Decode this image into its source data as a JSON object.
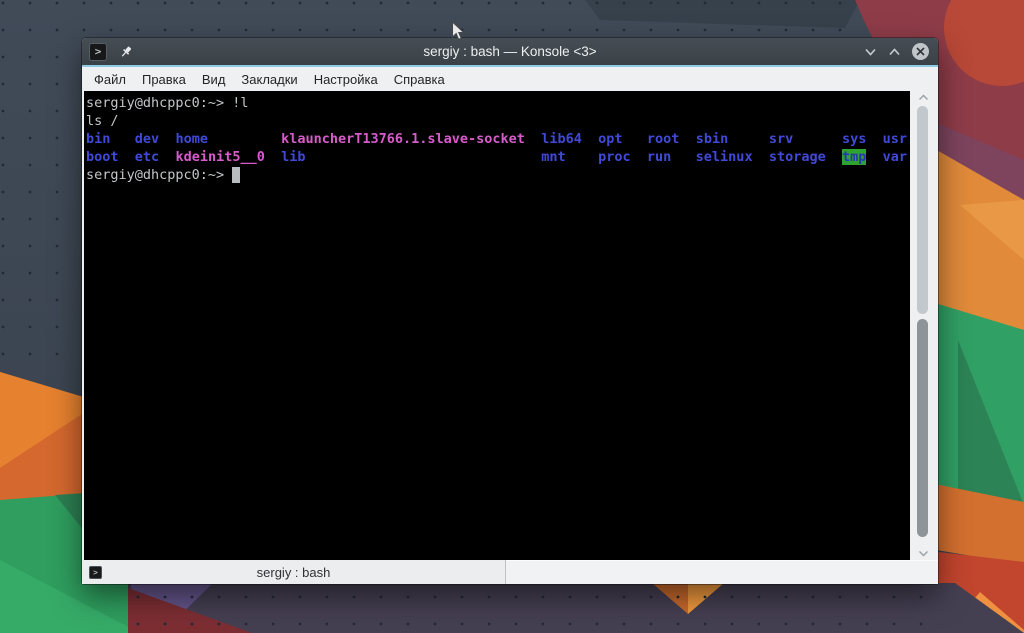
{
  "window": {
    "title": "sergiy : bash — Konsole <3>",
    "app_icon_glyph": ">",
    "titlebar_buttons": {
      "minimize": "chevron-down",
      "maximize": "chevron-up",
      "close": "circle-x",
      "pin": "keep-above-pin"
    },
    "menu": {
      "items": [
        "Файл",
        "Правка",
        "Вид",
        "Закладки",
        "Настройка",
        "Справка"
      ]
    },
    "terminal": {
      "colors": {
        "background": "#000000",
        "foreground": "#c3c7c9",
        "directory_blue": "#4149d9",
        "special_magenta": "#d75bcb",
        "tmp_background_green": "#2fa32f",
        "tmp_text_blue": "#2438b0",
        "cursor": "#b9bdbf"
      },
      "lines": [
        {
          "segments": [
            {
              "t": "sergiy@dhcppc0:~> !l"
            }
          ]
        },
        {
          "segments": [
            {
              "t": "ls /"
            }
          ]
        },
        {
          "segments": [
            {
              "t": "bin",
              "c": "dir"
            },
            {
              "t": "   "
            },
            {
              "t": "dev",
              "c": "dir"
            },
            {
              "t": "  "
            },
            {
              "t": "home",
              "c": "dir"
            },
            {
              "t": "         "
            },
            {
              "t": "klauncherT13766.1.slave-socket",
              "c": "mag"
            },
            {
              "t": "  "
            },
            {
              "t": "lib64",
              "c": "dir"
            },
            {
              "t": "  "
            },
            {
              "t": "opt",
              "c": "dir"
            },
            {
              "t": "   "
            },
            {
              "t": "root",
              "c": "dir"
            },
            {
              "t": "  "
            },
            {
              "t": "sbin",
              "c": "dir"
            },
            {
              "t": "     "
            },
            {
              "t": "srv",
              "c": "dir"
            },
            {
              "t": "      "
            },
            {
              "t": "sys",
              "c": "dir"
            },
            {
              "t": "  "
            },
            {
              "t": "usr",
              "c": "dir"
            }
          ]
        },
        {
          "segments": [
            {
              "t": "boot",
              "c": "dir"
            },
            {
              "t": "  "
            },
            {
              "t": "etc",
              "c": "dir"
            },
            {
              "t": "  "
            },
            {
              "t": "kdeinit5__0",
              "c": "mag"
            },
            {
              "t": "  "
            },
            {
              "t": "lib",
              "c": "dir"
            },
            {
              "t": "                             "
            },
            {
              "t": "mnt",
              "c": "dir"
            },
            {
              "t": "    "
            },
            {
              "t": "proc",
              "c": "dir"
            },
            {
              "t": "  "
            },
            {
              "t": "run",
              "c": "dir"
            },
            {
              "t": "   "
            },
            {
              "t": "selinux",
              "c": "dir"
            },
            {
              "t": "  "
            },
            {
              "t": "storage",
              "c": "dir"
            },
            {
              "t": "  "
            },
            {
              "t": "tmp",
              "c": "tmp"
            },
            {
              "t": "  "
            },
            {
              "t": "var",
              "c": "dir"
            }
          ]
        },
        {
          "segments": [
            {
              "t": "sergiy@dhcppc0:~> "
            },
            {
              "t": " ",
              "c": "cursor"
            }
          ]
        }
      ]
    },
    "tabbar": {
      "tabs": [
        {
          "label": "sergiy : bash"
        }
      ]
    }
  }
}
